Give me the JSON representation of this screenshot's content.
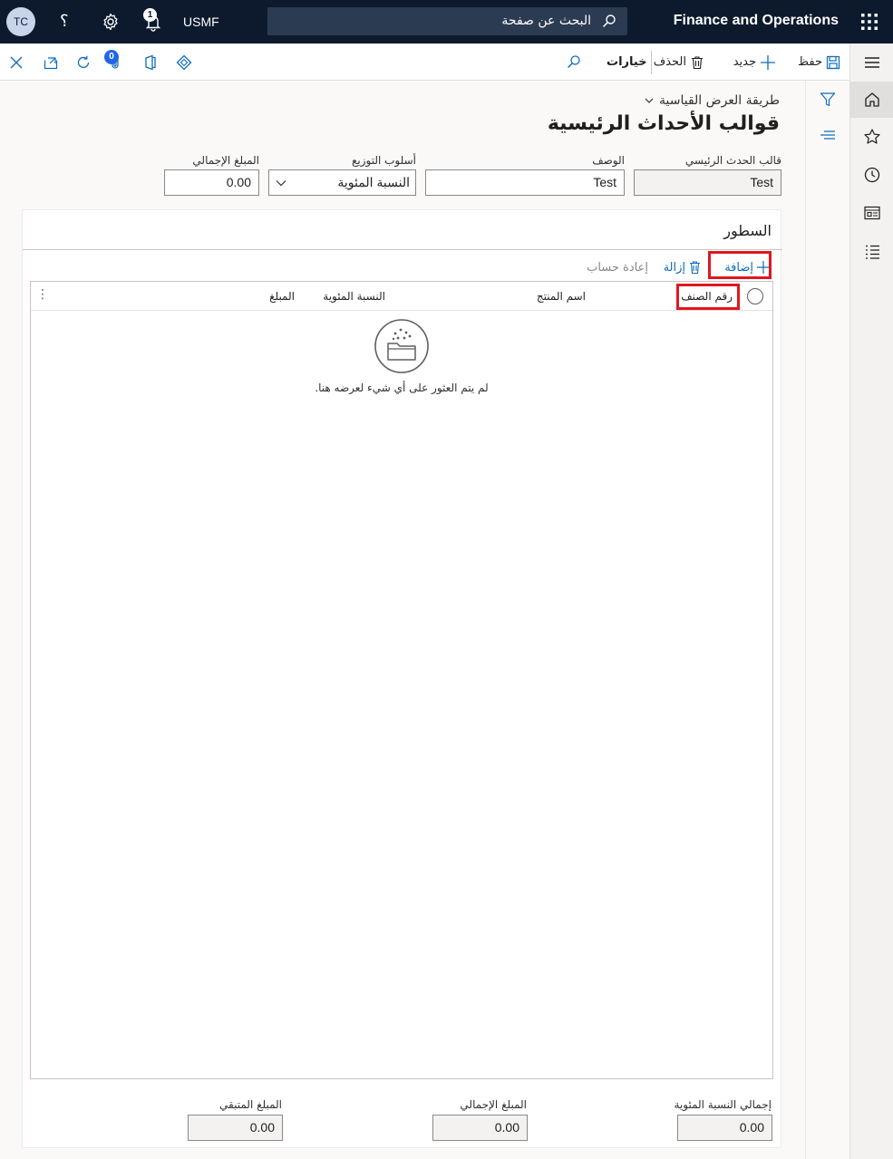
{
  "topbar": {
    "app_title": "Finance and Operations",
    "search_placeholder": "البحث عن صفحة",
    "company": "USMF",
    "notification_count": "1",
    "help_glyph": "؟",
    "avatar_initials": "TC",
    "icons": [
      "waffle-icon",
      "search-icon",
      "bell-icon",
      "gear-icon",
      "help-icon"
    ]
  },
  "actionbar": {
    "save": "حفظ",
    "new": "جديد",
    "delete": "الحذف",
    "options": "خيارات",
    "attachment_count": "0",
    "icons": [
      "save-icon",
      "plus-icon",
      "trash-icon",
      "find-icon",
      "office-icon",
      "attach-icon",
      "refresh-icon",
      "open-new-window-icon",
      "close-icon",
      "power-apps-icon"
    ]
  },
  "page": {
    "view_selector": "طريقة العرض القياسية",
    "title": "قوالب الأحداث الرئيسية"
  },
  "header_fields": {
    "template_label": "قالب الحدث الرئيسي",
    "template_value": "Test",
    "description_label": "الوصف",
    "description_value": "Test",
    "allocation_label": "أسلوب التوزيع",
    "allocation_value": "النسبة المئوية",
    "total_label": "المبلغ الإجمالي",
    "total_value": "0.00"
  },
  "lines": {
    "title": "السطور",
    "add": "إضافة",
    "remove": "إزالة",
    "recalc": "إعادة حساب",
    "columns": {
      "item_number": "رقم الصنف",
      "product_name": "اسم المنتج",
      "percentage": "النسبة المئوية",
      "amount": "المبلغ"
    },
    "empty_message": "لم يتم العثور على أي شيء لعرضه هنا."
  },
  "footer": {
    "total_pct_label": "إجمالي النسبة المئوية",
    "total_pct_value": "0.00",
    "total_amount_label": "المبلغ الإجمالي",
    "total_amount_value": "0.00",
    "remaining_label": "المبلغ المتبقي",
    "remaining_value": "0.00"
  },
  "rail": {
    "icons": [
      "hamburger-icon",
      "home-icon",
      "star-icon",
      "clock-icon",
      "workspace-icon",
      "list-icon"
    ]
  },
  "colors": {
    "nav_bg": "#0d1a2e",
    "accent": "#0f6cbd",
    "highlight": "#e0171e"
  }
}
